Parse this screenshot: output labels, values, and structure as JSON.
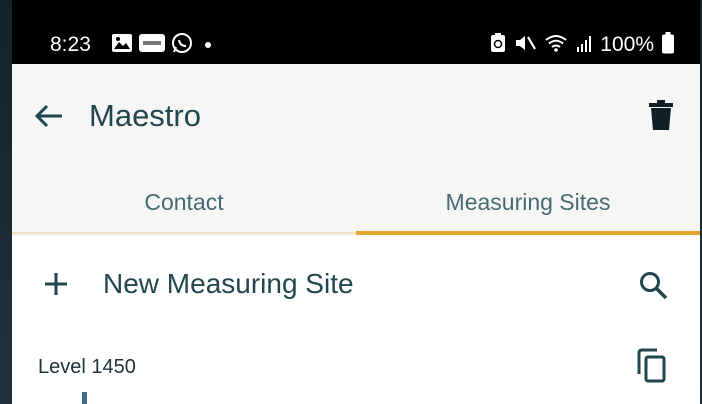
{
  "status_bar": {
    "time": "8:23",
    "battery": "100%",
    "left_icons": [
      "image-icon",
      "cbc-app-icon",
      "whatsapp-icon",
      "notification-dot"
    ],
    "right_icons": [
      "battery-saver-icon",
      "mute-icon",
      "wifi-icon",
      "signal-icon",
      "battery-icon"
    ]
  },
  "app_bar": {
    "title": "Maestro",
    "back_icon": "arrow-left",
    "delete_icon": "trash"
  },
  "tabs": [
    {
      "label": "Contact",
      "selected": false
    },
    {
      "label": "Measuring Sites",
      "selected": true
    }
  ],
  "content": {
    "new_site_label": "New Measuring Site",
    "add_icon": "plus",
    "search_icon": "magnifier",
    "first_item": {
      "label": "Level 1450",
      "copy_icon": "copy"
    }
  },
  "colors": {
    "primary_text": "#21464f",
    "tab_text": "#476a72",
    "accent": "#e3a62a",
    "surface": "#f6f6f4",
    "status_bar": "#000000"
  }
}
